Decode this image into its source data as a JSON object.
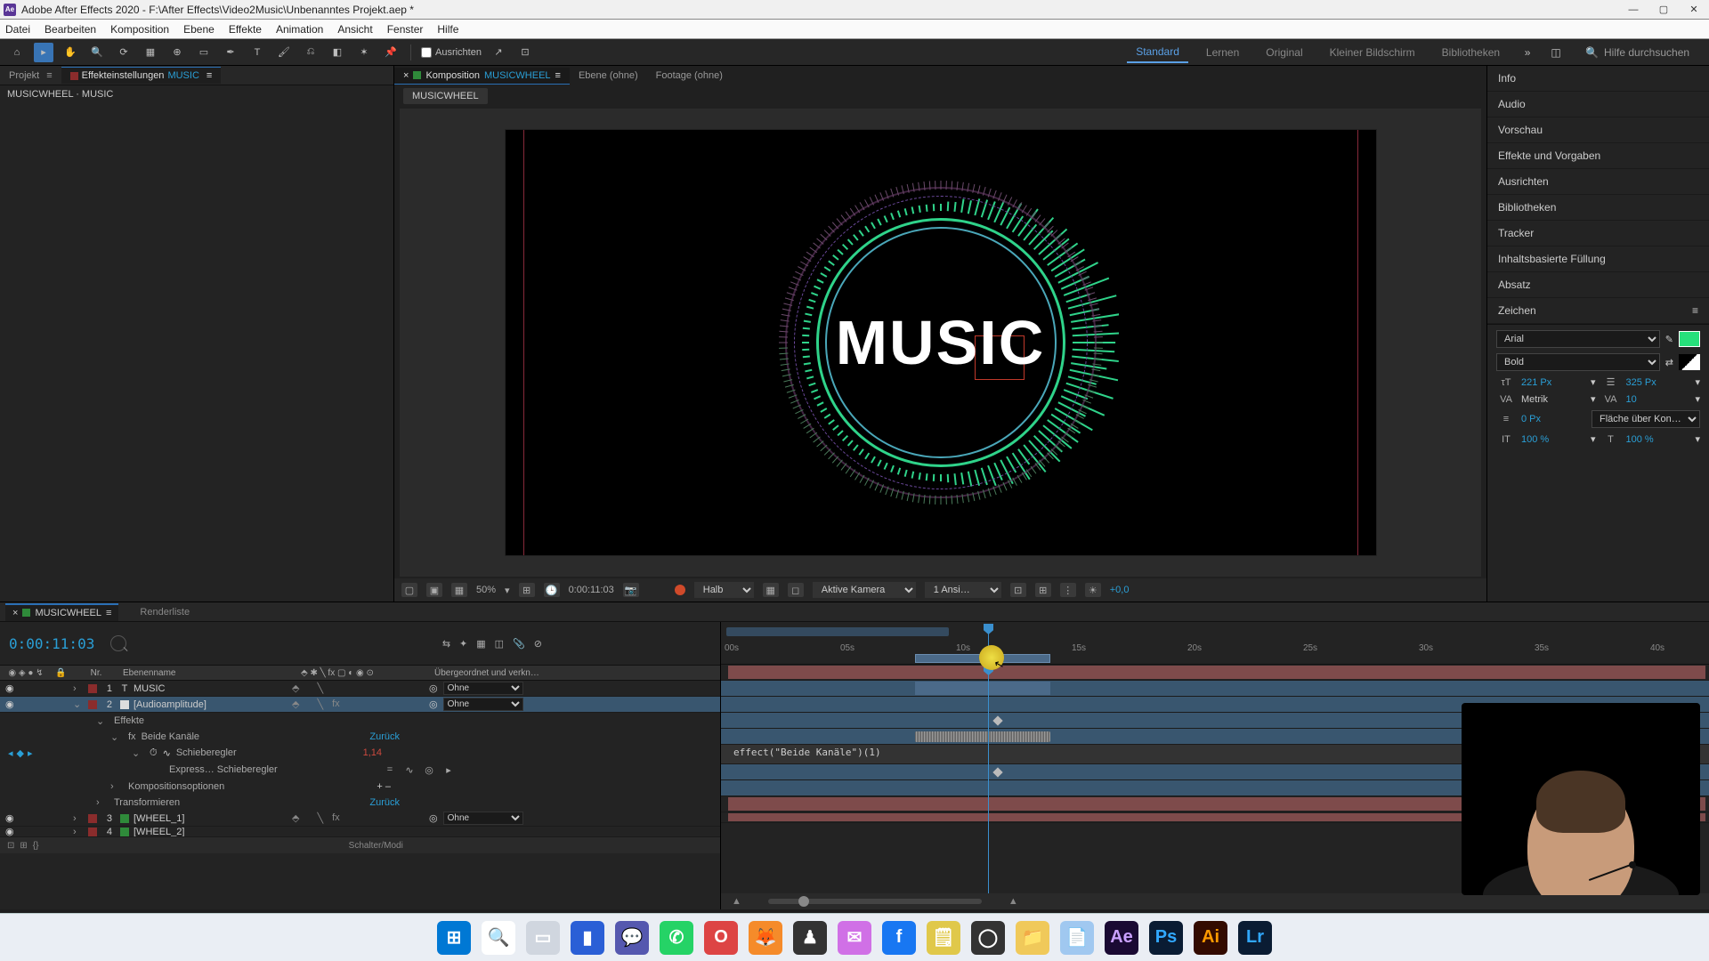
{
  "app": {
    "title": "Adobe After Effects 2020 - F:\\After Effects\\Video2Music\\Unbenanntes Projekt.aep *",
    "icon_label": "Ae"
  },
  "menu": [
    "Datei",
    "Bearbeiten",
    "Komposition",
    "Ebene",
    "Effekte",
    "Animation",
    "Ansicht",
    "Fenster",
    "Hilfe"
  ],
  "toolbar": {
    "align_checkbox": "Ausrichten",
    "workspaces": [
      "Standard",
      "Lernen",
      "Original",
      "Kleiner Bildschirm",
      "Bibliotheken"
    ],
    "active_workspace": "Standard",
    "search_placeholder": "Hilfe durchsuchen"
  },
  "left_panel": {
    "tabs": [
      {
        "label": "Projekt",
        "active": false
      },
      {
        "label": "Effekteinstellungen",
        "layer": "MUSIC",
        "active": true
      }
    ],
    "breadcrumb": "MUSICWHEEL · MUSIC"
  },
  "comp_panel": {
    "tabs": [
      {
        "prefix": "Komposition",
        "name": "MUSICWHEEL",
        "active": true
      },
      {
        "label": "Ebene (ohne)"
      },
      {
        "label": "Footage (ohne)"
      }
    ],
    "crumb": "MUSICWHEEL",
    "viewer_text": "MUSIC",
    "footer": {
      "zoom": "50%",
      "timecode": "0:00:11:03",
      "resolution": "Halb",
      "camera": "Aktive Kamera",
      "views": "1 Ansi…",
      "exposure": "+0,0"
    }
  },
  "right_panel": {
    "items": [
      "Info",
      "Audio",
      "Vorschau",
      "Effekte und Vorgaben",
      "Ausrichten",
      "Bibliotheken",
      "Tracker",
      "Inhaltsbasierte Füllung",
      "Absatz"
    ],
    "character": {
      "title": "Zeichen",
      "font": "Arial",
      "style": "Bold",
      "size": "221 Px",
      "leading": "325 Px",
      "kerning": "Metrik",
      "tracking": "10",
      "stroke": "0 Px",
      "stroke_mode": "Fläche über Kon…",
      "vscale": "100 %",
      "hscale": "100 %"
    }
  },
  "timeline": {
    "tab": "MUSICWHEEL",
    "tab2": "Renderliste",
    "timecode": "0:00:11:03",
    "cols": {
      "num": "Nr.",
      "name": "Ebenenname",
      "parent": "Übergeordnet und verkn…"
    },
    "none": "Ohne",
    "layers": [
      {
        "num": "1",
        "name": "MUSIC",
        "type": "T",
        "color": "#8a2c2c",
        "parent": "Ohne",
        "fx": false
      },
      {
        "num": "2",
        "name": "[Audioamplitude]",
        "type": "solid",
        "color": "#8a2c2c",
        "parent": "Ohne",
        "fx": true,
        "selected": true
      },
      {
        "num": "3",
        "name": "[WHEEL_1]",
        "type": "comp",
        "color": "#2f8a3a",
        "parent": "Ohne",
        "fx": true
      },
      {
        "num": "4",
        "name": "[WHEEL_2]",
        "type": "comp",
        "color": "#2f8a3a",
        "parent": "Ohne",
        "fx": true
      }
    ],
    "props": {
      "effects": "Effekte",
      "fx_name": "Beide Kanäle",
      "fx_reset": "Zurück",
      "slider": "Schieberegler",
      "slider_val": "1,14",
      "expr_label": "Express… Schieberegler",
      "expr_code": "effect(\"Beide Kanäle\")(1)",
      "comp_opts": "Kompositionsoptionen",
      "transform": "Transformieren",
      "transform_reset": "Zurück"
    },
    "footer_left": "Schalter/Modi",
    "ruler": [
      "00s",
      "05s",
      "10s",
      "15s",
      "20s",
      "25s",
      "30s",
      "35s",
      "40s"
    ]
  },
  "taskbar": [
    {
      "name": "start",
      "bg": "#0078d4",
      "glyph": "⊞"
    },
    {
      "name": "search",
      "bg": "#ffffff",
      "glyph": "🔍"
    },
    {
      "name": "task-view",
      "bg": "#d0d6df",
      "glyph": "▭"
    },
    {
      "name": "app1",
      "bg": "#2a5fd6",
      "glyph": "▮"
    },
    {
      "name": "teams",
      "bg": "#5558af",
      "glyph": "💬"
    },
    {
      "name": "whatsapp",
      "bg": "#25d366",
      "glyph": "✆"
    },
    {
      "name": "opera",
      "bg": "#d44",
      "glyph": "O"
    },
    {
      "name": "firefox",
      "bg": "#f58b2a",
      "glyph": "🦊"
    },
    {
      "name": "app2",
      "bg": "#333",
      "glyph": "♟"
    },
    {
      "name": "messenger",
      "bg": "#d070e6",
      "glyph": "✉"
    },
    {
      "name": "facebook",
      "bg": "#1877f2",
      "glyph": "f"
    },
    {
      "name": "notes",
      "bg": "#e0c84a",
      "glyph": "🗒"
    },
    {
      "name": "obs",
      "bg": "#333",
      "glyph": "◯"
    },
    {
      "name": "explorer",
      "bg": "#f0c95a",
      "glyph": "📁"
    },
    {
      "name": "notepad",
      "bg": "#a0c8f0",
      "glyph": "📄"
    },
    {
      "name": "ae",
      "bg": "#1a0a33",
      "glyph": "Ae",
      "fg": "#c9a0ff"
    },
    {
      "name": "ps",
      "bg": "#0a1c33",
      "glyph": "Ps",
      "fg": "#31a8ff"
    },
    {
      "name": "ai",
      "bg": "#330b00",
      "glyph": "Ai",
      "fg": "#ff9a00"
    },
    {
      "name": "lr",
      "bg": "#0a1c33",
      "glyph": "Lr",
      "fg": "#31a8ff"
    }
  ]
}
